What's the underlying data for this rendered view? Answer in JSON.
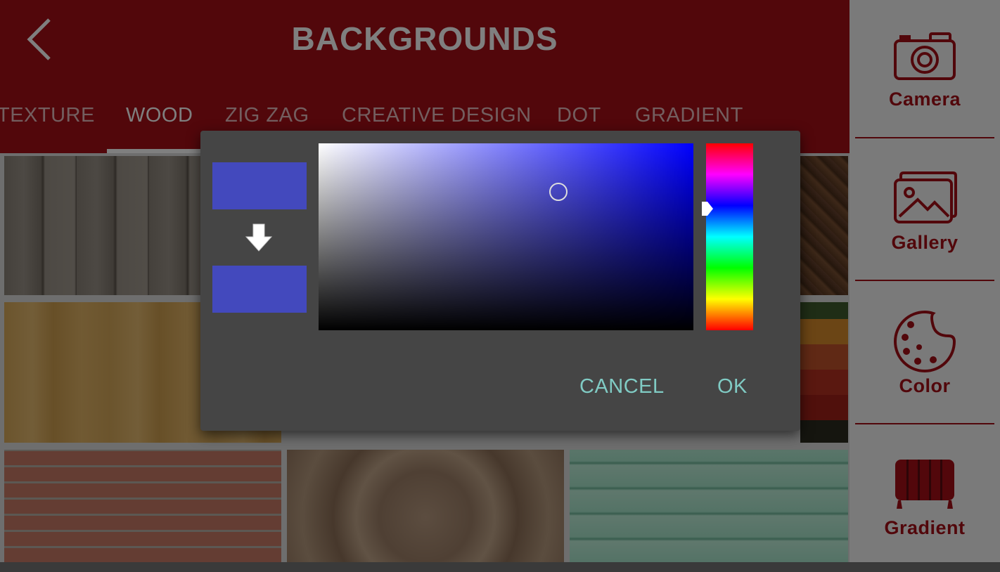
{
  "header": {
    "title": "BACKGROUNDS",
    "back_icon": "chevron-left-icon",
    "color": "#a50e16"
  },
  "tabs": [
    {
      "label": "TEXTURE"
    },
    {
      "label": "WOOD",
      "active": true
    },
    {
      "label": "ZIG ZAG"
    },
    {
      "label": "CREATIVE DESIGN"
    },
    {
      "label": "DOT"
    },
    {
      "label": "GRADIENT"
    }
  ],
  "tiles": [
    {
      "name": "grey-planks"
    },
    {
      "name": "light-pine"
    },
    {
      "name": "herringbone"
    },
    {
      "name": "dark-planks"
    },
    {
      "name": "brick-wall"
    },
    {
      "name": "carved-pattern"
    },
    {
      "name": "mint-planks"
    }
  ],
  "sidebar": {
    "items": [
      {
        "label": "Camera",
        "icon": "camera-icon"
      },
      {
        "label": "Gallery",
        "icon": "gallery-icon"
      },
      {
        "label": "Color",
        "icon": "palette-icon"
      },
      {
        "label": "Gradient",
        "icon": "gradient-icon"
      }
    ]
  },
  "color_picker": {
    "old_color": "#4349bd",
    "new_color": "#4349bd",
    "hue_color": "#0000ff",
    "hue_level": 0.35,
    "saturation": 0.64,
    "brightness": 0.74,
    "cancel_label": "CANCEL",
    "ok_label": "OK",
    "arrow_icon": "arrow-down-icon"
  }
}
